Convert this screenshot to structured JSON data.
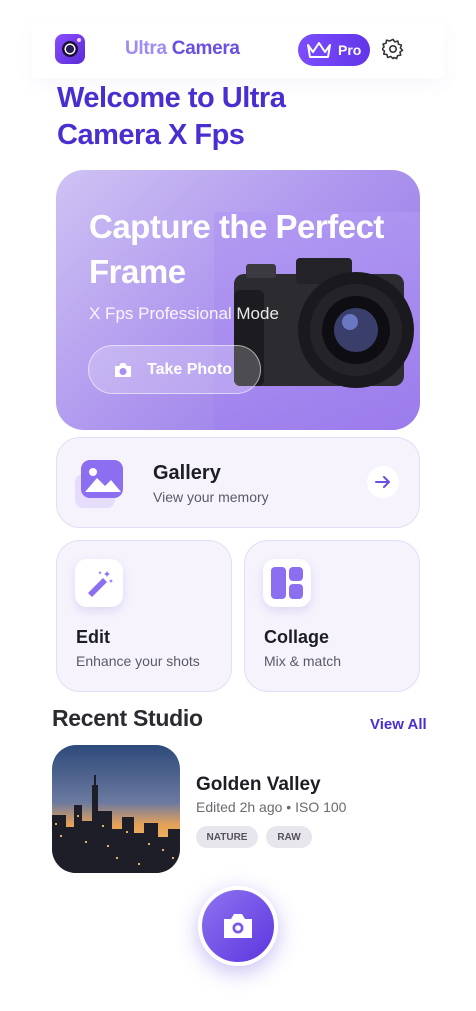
{
  "header": {
    "app_icon": "camera-lens-icon",
    "title_part1": "Ultra",
    "title_part2": "Camera",
    "pro_label": "Pro",
    "pro_icon": "crown-icon",
    "settings_icon": "gear-icon"
  },
  "welcome": {
    "text": "Welcome to Ultra Camera X Fps"
  },
  "hero": {
    "title": "Capture the Perfect Frame",
    "subtitle": "X Fps Professional Mode",
    "button_label": "Take Photo",
    "button_icon": "camera-icon"
  },
  "gallery": {
    "title": "Gallery",
    "subtitle": "View your memory",
    "icon": "image-stack-icon",
    "action_icon": "arrow-right-icon"
  },
  "tiles": [
    {
      "title": "Edit",
      "subtitle": "Enhance your shots",
      "icon": "magic-wand-icon"
    },
    {
      "title": "Collage",
      "subtitle": "Mix & match",
      "icon": "collage-layout-icon"
    }
  ],
  "recent": {
    "title": "Recent Studio",
    "view_all": "View All",
    "items": [
      {
        "title": "Golden Valley",
        "meta": "Edited 2h ago • ISO 100",
        "tags": [
          "NATURE",
          "RAW"
        ]
      }
    ]
  },
  "fab": {
    "icon": "camera-icon"
  },
  "colors": {
    "accent": "#4a2ed0",
    "brand": "#6236e8",
    "card_bg": "#f6f3fd"
  }
}
